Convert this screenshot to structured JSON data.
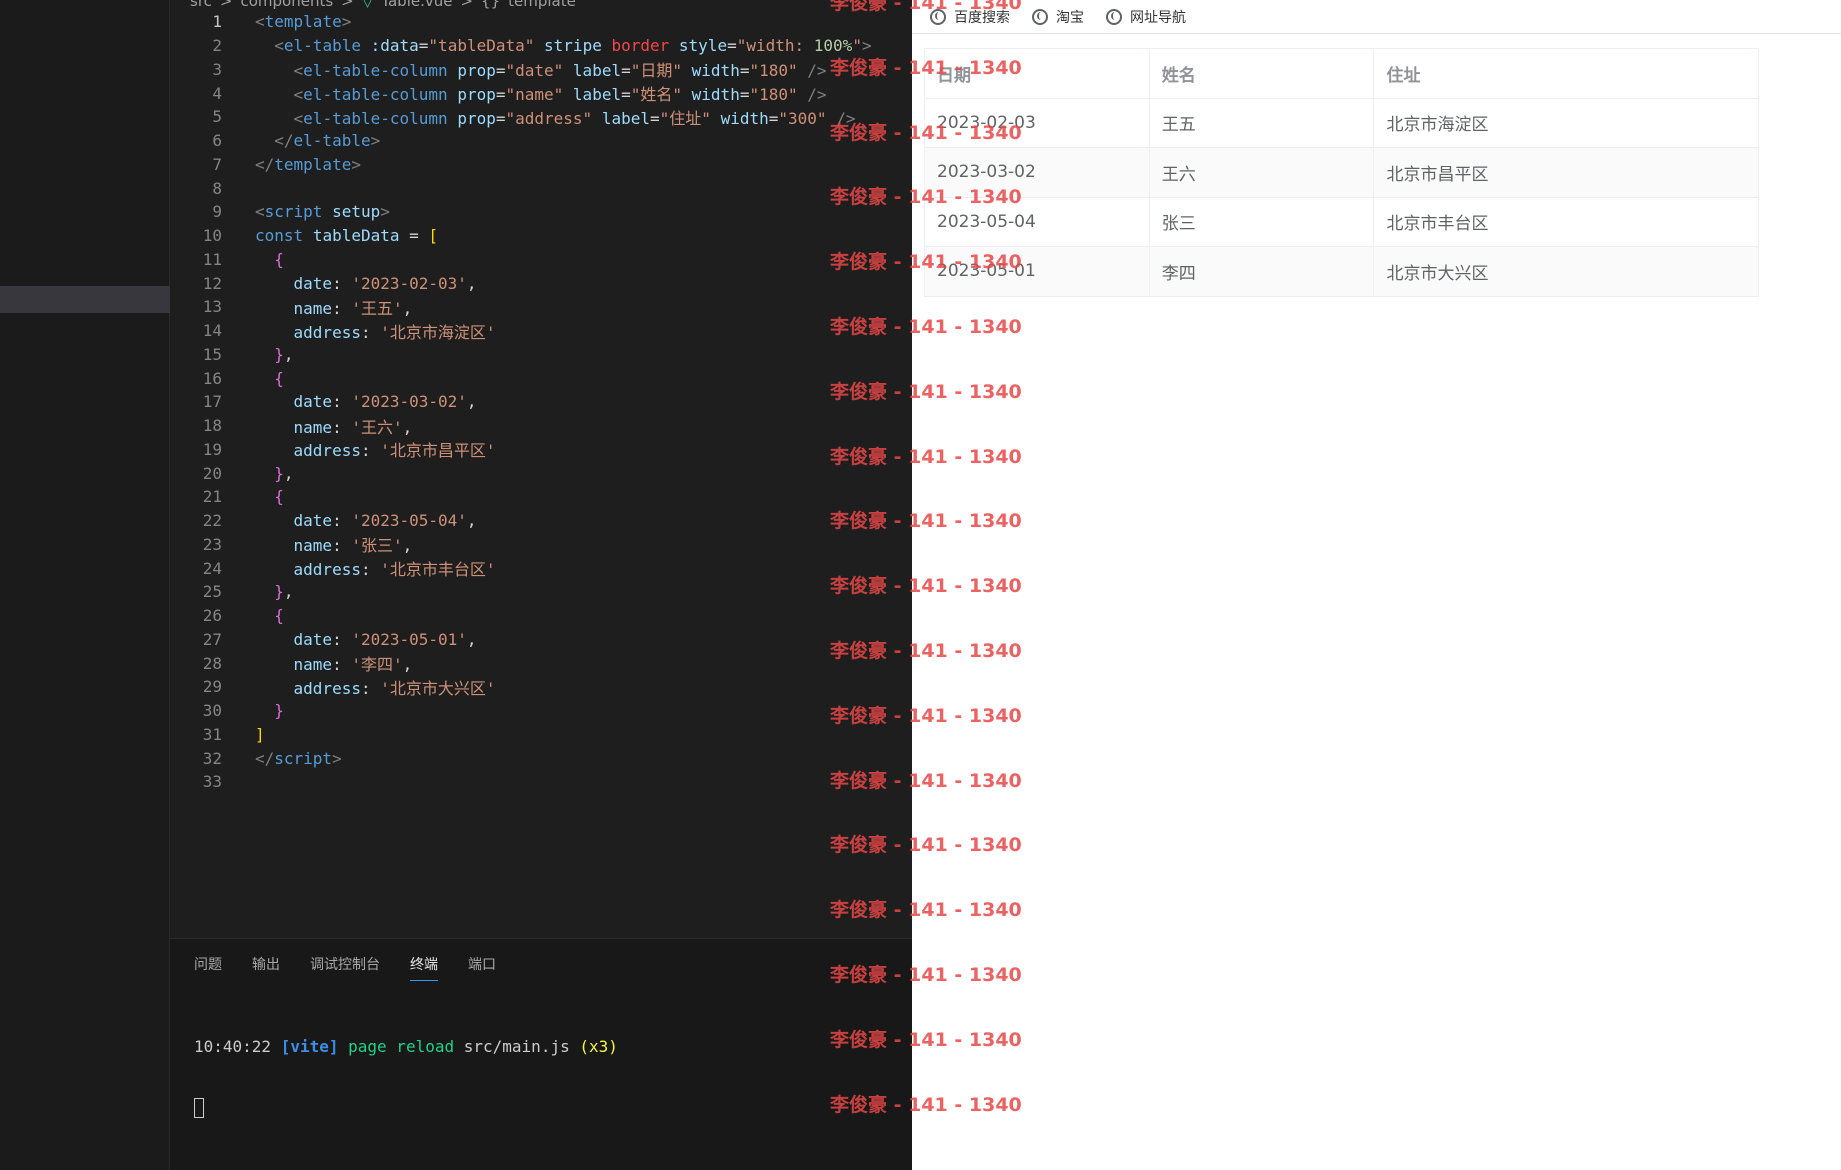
{
  "editor": {
    "breadcrumb": [
      "src",
      ">",
      "components",
      ">",
      "▽",
      "Table.vue",
      ">",
      "{}",
      "template"
    ],
    "lines": [
      {
        "n": "1",
        "html": "<span class='punc'>&lt;</span><span class='tag'>template</span><span class='punc'>&gt;</span>"
      },
      {
        "n": "2",
        "html": "  <span class='punc'>&lt;</span><span class='tag'>el-table</span> <span class='attr'>:data</span>=<span class='str'>\"tableData\"</span> <span class='attr'>stripe</span> <span class='red'>border</span> <span class='attr'>style</span>=<span class='str'>\"width: <span class='num'>100%</span>\"</span><span class='punc'>&gt;</span>"
      },
      {
        "n": "3",
        "html": "    <span class='punc'>&lt;</span><span class='tag'>el-table-column</span> <span class='attr'>prop</span>=<span class='str'>\"date\"</span> <span class='attr'>label</span>=<span class='str'>\"日期\"</span> <span class='attr'>width</span>=<span class='str'>\"180\"</span> <span class='punc'>/&gt;</span>"
      },
      {
        "n": "4",
        "html": "    <span class='punc'>&lt;</span><span class='tag'>el-table-column</span> <span class='attr'>prop</span>=<span class='str'>\"name\"</span> <span class='attr'>label</span>=<span class='str'>\"姓名\"</span> <span class='attr'>width</span>=<span class='str'>\"180\"</span> <span class='punc'>/&gt;</span>"
      },
      {
        "n": "5",
        "html": "    <span class='punc'>&lt;</span><span class='tag'>el-table-column</span> <span class='attr'>prop</span>=<span class='str'>\"address\"</span> <span class='attr'>label</span>=<span class='str'>\"住址\"</span> <span class='attr'>width</span>=<span class='str'>\"300\"</span> <span class='punc'>/&gt;</span>"
      },
      {
        "n": "6",
        "html": "  <span class='punc'>&lt;/</span><span class='tag'>el-table</span><span class='punc'>&gt;</span>"
      },
      {
        "n": "7",
        "html": "<span class='punc'>&lt;/</span><span class='tag'>template</span><span class='punc'>&gt;</span>"
      },
      {
        "n": "8",
        "html": ""
      },
      {
        "n": "9",
        "html": "<span class='punc'>&lt;</span><span class='tag'>script</span> <span class='attr'>setup</span><span class='punc'>&gt;</span>"
      },
      {
        "n": "10",
        "html": "<span class='kw'>const</span> <span class='var'>tableData</span> = <span class='brace0'>[</span>"
      },
      {
        "n": "11",
        "html": "  <span class='brace1'>{</span>"
      },
      {
        "n": "12",
        "html": "    <span class='var'>date</span>: <span class='str'>'2023-02-03'</span>,"
      },
      {
        "n": "13",
        "html": "    <span class='var'>name</span>: <span class='str'>'王五'</span>,"
      },
      {
        "n": "14",
        "html": "    <span class='var'>address</span>: <span class='str'>'北京市海淀区'</span>"
      },
      {
        "n": "15",
        "html": "  <span class='brace1'>}</span>,"
      },
      {
        "n": "16",
        "html": "  <span class='brace1'>{</span>"
      },
      {
        "n": "17",
        "html": "    <span class='var'>date</span>: <span class='str'>'2023-03-02'</span>,"
      },
      {
        "n": "18",
        "html": "    <span class='var'>name</span>: <span class='str'>'王六'</span>,"
      },
      {
        "n": "19",
        "html": "    <span class='var'>address</span>: <span class='str'>'北京市昌平区'</span>"
      },
      {
        "n": "20",
        "html": "  <span class='brace1'>}</span>,"
      },
      {
        "n": "21",
        "html": "  <span class='brace1'>{</span>"
      },
      {
        "n": "22",
        "html": "    <span class='var'>date</span>: <span class='str'>'2023-05-04'</span>,"
      },
      {
        "n": "23",
        "html": "    <span class='var'>name</span>: <span class='str'>'张三'</span>,"
      },
      {
        "n": "24",
        "html": "    <span class='var'>address</span>: <span class='str'>'北京市丰台区'</span>"
      },
      {
        "n": "25",
        "html": "  <span class='brace1'>}</span>,"
      },
      {
        "n": "26",
        "html": "  <span class='brace1'>{</span>"
      },
      {
        "n": "27",
        "html": "    <span class='var'>date</span>: <span class='str'>'2023-05-01'</span>,"
      },
      {
        "n": "28",
        "html": "    <span class='var'>name</span>: <span class='str'>'李四'</span>,"
      },
      {
        "n": "29",
        "html": "    <span class='var'>address</span>: <span class='str'>'北京市大兴区'</span>"
      },
      {
        "n": "30",
        "html": "  <span class='brace1'>}</span>"
      },
      {
        "n": "31",
        "html": "<span class='brace0'>]</span>"
      },
      {
        "n": "32",
        "html": "<span class='punc'>&lt;/</span><span class='tag'>script</span><span class='punc'>&gt;</span>"
      },
      {
        "n": "33",
        "html": ""
      }
    ]
  },
  "panel": {
    "tabs": [
      "问题",
      "输出",
      "调试控制台",
      "终端",
      "端口"
    ],
    "active_tab": "终端",
    "terminal": {
      "time": "10:40:22",
      "tag": "[vite]",
      "msg": "page reload",
      "file": "src/main.js",
      "count": "(x3)"
    }
  },
  "browser": {
    "bookmarks": [
      "百度搜索",
      "淘宝",
      "网址导航"
    ],
    "table": {
      "headers": [
        "日期",
        "姓名",
        "住址"
      ],
      "rows": [
        [
          "2023-02-03",
          "王五",
          "北京市海淀区"
        ],
        [
          "2023-03-02",
          "王六",
          "北京市昌平区"
        ],
        [
          "2023-05-04",
          "张三",
          "北京市丰台区"
        ],
        [
          "2023-05-01",
          "李四",
          "北京市大兴区"
        ]
      ]
    }
  },
  "watermark": {
    "text": "李俊豪 - 141 - 1340",
    "count": 18
  }
}
